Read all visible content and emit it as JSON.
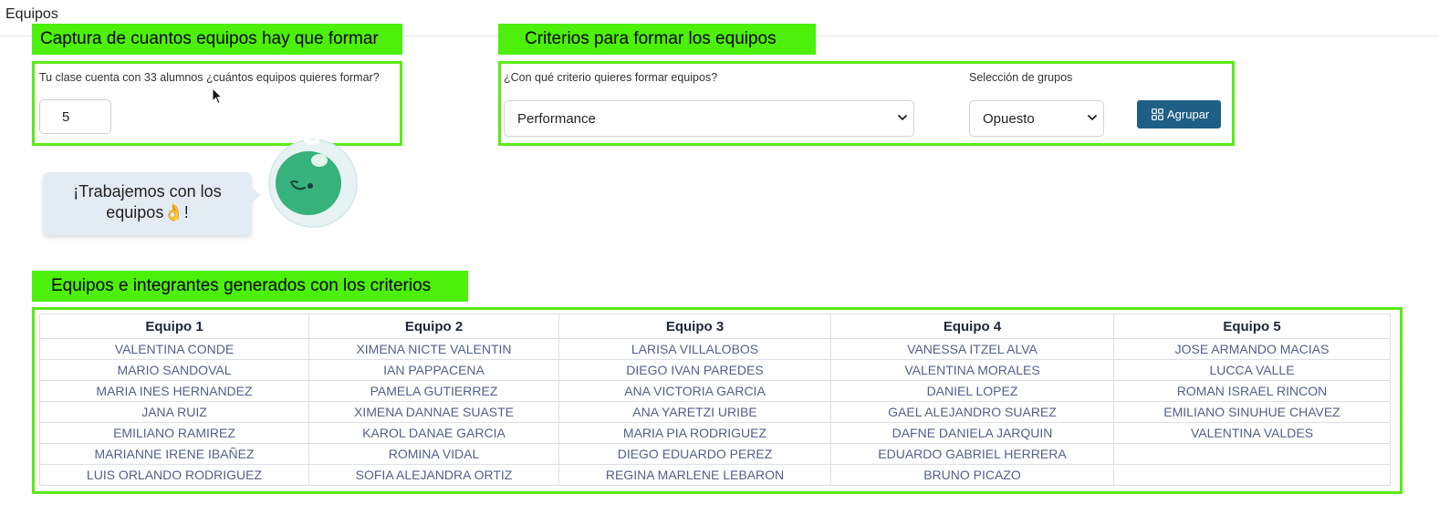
{
  "header": {
    "title": "Equipos"
  },
  "capture": {
    "section_label": "Captura de cuantos equipos hay que formar",
    "question": "Tu clase cuenta con 33 alumnos ¿cuántos equipos quieres formar?",
    "team_count_value": "5"
  },
  "criteria": {
    "section_label": "Criterios para formar los equipos",
    "criterion_label": "¿Con qué criterio quieres formar equipos?",
    "criterion_selected": "Performance",
    "grouping_label": "Selección de grupos",
    "grouping_selected": "Opuesto",
    "group_button_label": "Agrupar"
  },
  "mascot": {
    "message_line1": "¡Trabajemos con los",
    "message_line2": "equipos👌!"
  },
  "results": {
    "section_label": "Equipos e integrantes generados con los criterios",
    "columns": [
      "Equipo 1",
      "Equipo 2",
      "Equipo 3",
      "Equipo 4",
      "Equipo 5"
    ],
    "rows": [
      [
        "VALENTINA CONDE",
        "XIMENA NICTE VALENTIN",
        "LARISA VILLALOBOS",
        "VANESSA ITZEL ALVA",
        "JOSE ARMANDO MACIAS"
      ],
      [
        "MARIO SANDOVAL",
        "IAN PAPPACENA",
        "DIEGO IVAN PAREDES",
        "VALENTINA MORALES",
        "LUCCA VALLE"
      ],
      [
        "MARIA INES HERNANDEZ",
        "PAMELA GUTIERREZ",
        "ANA VICTORIA GARCIA",
        "DANIEL LOPEZ",
        "ROMAN ISRAEL RINCON"
      ],
      [
        "JANA RUIZ",
        "XIMENA DANNAE SUASTE",
        "ANA YARETZI URIBE",
        "GAEL ALEJANDRO SUAREZ",
        "EMILIANO SINUHUE CHAVEZ"
      ],
      [
        "EMILIANO RAMIREZ",
        "KAROL DANAE GARCIA",
        "MARIA PIA RODRIGUEZ",
        "DAFNE DANIELA JARQUIN",
        "VALENTINA VALDES"
      ],
      [
        "MARIANNE IRENE IBAÑEZ",
        "ROMINA VIDAL",
        "DIEGO EDUARDO PEREZ",
        "EDUARDO GABRIEL HERRERA",
        ""
      ],
      [
        "LUIS ORLANDO RODRIGUEZ",
        "SOFIA ALEJANDRA ORTIZ",
        "REGINA MARLENE LEBARON",
        "BRUNO PICAZO",
        ""
      ]
    ]
  },
  "colors": {
    "highlight_green": "#4cf00a",
    "button_blue": "#1f5f86",
    "mascot_green": "#37b27c",
    "bubble_bg": "#e3ebf4",
    "table_text": "#53618a"
  }
}
